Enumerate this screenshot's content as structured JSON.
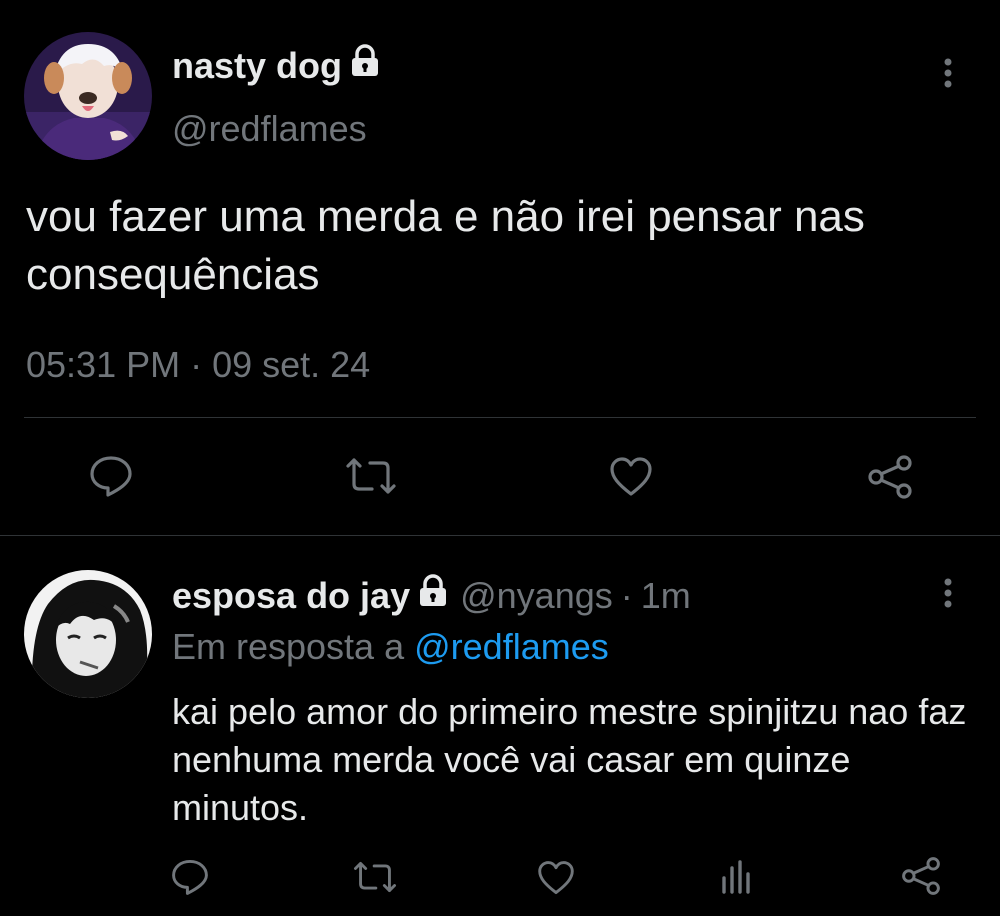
{
  "main_tweet": {
    "display_name": "nasty dog",
    "handle": "@redflames",
    "text": "vou fazer uma merda e não irei pensar nas consequências",
    "timestamp": "05:31 PM · 09 set. 24",
    "protected_icon": "lock-icon",
    "actions": [
      "reply-icon",
      "retweet-icon",
      "like-icon",
      "share-icon"
    ]
  },
  "reply_tweet": {
    "display_name": "esposa do jay",
    "handle": "@nyangs",
    "separator": "·",
    "time": "1m",
    "reply_context_prefix": "Em resposta a",
    "reply_context_mention": "@redflames",
    "text": "kai pelo amor do primeiro mestre spinjitzu nao faz nenhuma merda você vai casar em quinze minutos.",
    "protected_icon": "lock-icon",
    "actions": [
      "reply-icon",
      "retweet-icon",
      "like-icon",
      "analytics-icon",
      "share-icon"
    ]
  },
  "colors": {
    "background": "#000000",
    "primary_text": "#e7e9ea",
    "secondary_text": "#71767b",
    "accent": "#1d9bf0",
    "divider": "#2f3336"
  }
}
